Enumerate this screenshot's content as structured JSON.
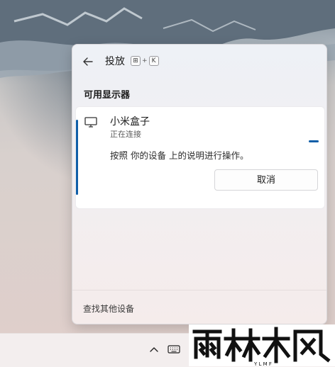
{
  "cast_panel": {
    "title": "投放",
    "shortcut": {
      "win_key": "⊞",
      "plus": "+",
      "letter_key": "K"
    },
    "section_title": "可用显示器",
    "device": {
      "name": "小米盒子",
      "status": "正在连接",
      "instruction": "按照 你的设备 上的说明进行操作。",
      "cancel_label": "取消"
    },
    "footer_link": "查找其他设备"
  },
  "watermark": {
    "text": "雨林木风",
    "subtext": "YLMF"
  },
  "colors": {
    "accent": "#0f5ea8",
    "panel_bg": "#eef1f6",
    "taskbar_bg": "#f3eeee"
  },
  "icons": {
    "back": "back-arrow-icon",
    "monitor": "monitor-icon",
    "tray_chevron": "chevron-up-icon",
    "keyboard": "keyboard-icon"
  }
}
